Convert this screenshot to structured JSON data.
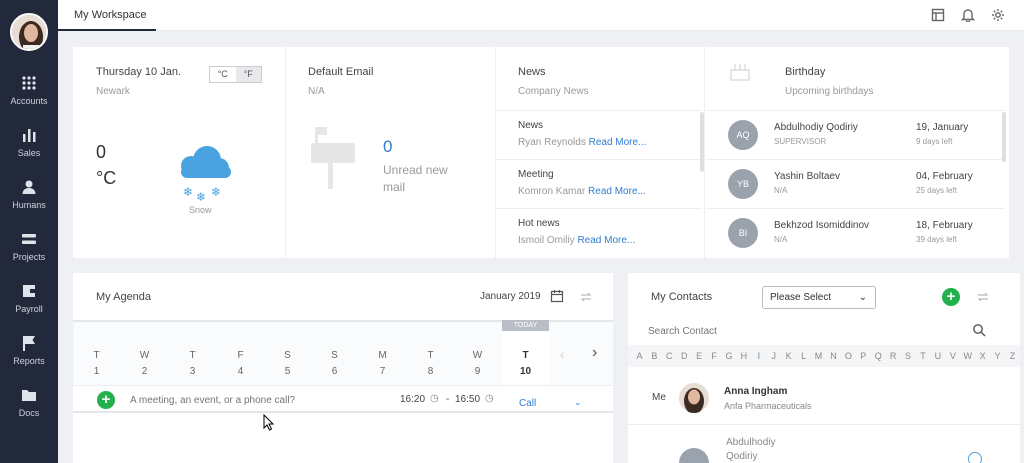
{
  "sidebar": {
    "items": [
      {
        "label": "Accounts",
        "icon": "grid-icon"
      },
      {
        "label": "Sales",
        "icon": "bar-chart-icon"
      },
      {
        "label": "Humans",
        "icon": "person-icon"
      },
      {
        "label": "Projects",
        "icon": "projects-icon"
      },
      {
        "label": "Payroll",
        "icon": "wallet-icon"
      },
      {
        "label": "Reports",
        "icon": "flag-icon"
      },
      {
        "label": "Docs",
        "icon": "folder-icon"
      }
    ]
  },
  "header": {
    "tab": "My Workspace"
  },
  "weather": {
    "date": "Thursday 10 Jan.",
    "city": "Newark",
    "unit_c": "°C",
    "unit_f": "°F",
    "temp": "0",
    "temp_unit": "°C",
    "condition": "Snow"
  },
  "email": {
    "title": "Default Email",
    "value": "N/A",
    "count": "0",
    "label": "Unread new mail"
  },
  "news": {
    "title": "News",
    "subtitle": "Company News",
    "items": [
      {
        "title": "News",
        "author": "Ryan Reynolds",
        "more": "Read More..."
      },
      {
        "title": "Meeting",
        "author": "Komron Kamar",
        "more": "Read More..."
      },
      {
        "title": "Hot news",
        "author": "Ismoil Omiliy",
        "more": "Read More..."
      }
    ]
  },
  "birthday": {
    "title": "Birthday",
    "subtitle": "Upcoming birthdays",
    "items": [
      {
        "initials": "AQ",
        "name": "Abdulhodiy Qodiriy",
        "role": "SUPERVISOR",
        "date": "19, January",
        "left": "9 days left"
      },
      {
        "initials": "YB",
        "name": "Yashin Boltaev",
        "role": "N/A",
        "date": "04, February",
        "left": "25 days left"
      },
      {
        "initials": "BI",
        "name": "Bekhzod Isomiddinov",
        "role": "N/A",
        "date": "18, February",
        "left": "39 days left"
      }
    ]
  },
  "agenda": {
    "title": "My Agenda",
    "month": "January 2019",
    "today_badge": "TODAY",
    "days": [
      {
        "d": "T",
        "n": "1"
      },
      {
        "d": "W",
        "n": "2"
      },
      {
        "d": "T",
        "n": "3"
      },
      {
        "d": "F",
        "n": "4"
      },
      {
        "d": "S",
        "n": "5"
      },
      {
        "d": "S",
        "n": "6"
      },
      {
        "d": "M",
        "n": "7"
      },
      {
        "d": "T",
        "n": "8"
      },
      {
        "d": "W",
        "n": "9"
      },
      {
        "d": "T",
        "n": "10"
      }
    ],
    "placeholder": "A meeting, an event, or a phone call?",
    "time_start": "16:20",
    "time_end": "16:50",
    "time_sep": "-",
    "type": "Call"
  },
  "contacts": {
    "title": "My Contacts",
    "select": "Please Select",
    "search_placeholder": "Search Contact",
    "letters": [
      "A",
      "B",
      "C",
      "D",
      "E",
      "F",
      "G",
      "H",
      "I",
      "J",
      "K",
      "L",
      "M",
      "N",
      "O",
      "P",
      "Q",
      "R",
      "S",
      "T",
      "U",
      "V",
      "W",
      "X",
      "Y",
      "Z"
    ],
    "me_label": "Me",
    "me_name": "Anna Ingham",
    "me_company": "Anfa Pharmaceuticals",
    "next_name_1": "Abdulhodiy",
    "next_name_2": "Qodiriy"
  },
  "colors": {
    "sidebar": "#22293a",
    "accent": "#2f7dd1",
    "green": "#22b14c"
  }
}
